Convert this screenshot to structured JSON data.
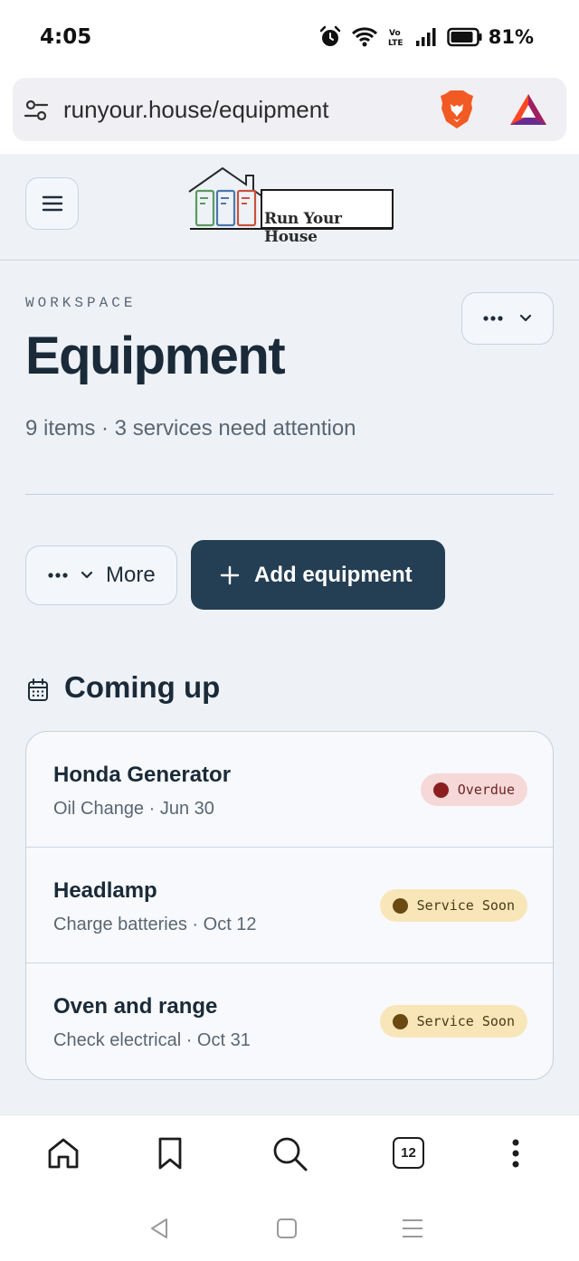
{
  "status_bar": {
    "time": "4:05",
    "battery_percent": "81%",
    "icons": [
      "alarm-icon",
      "wifi-icon",
      "volte-icon",
      "signal-icon",
      "battery-icon"
    ],
    "volte_label": "Vo LTE"
  },
  "browser": {
    "url": "runyour.house/equipment",
    "tabs_count": "12",
    "icons": [
      "site-settings-icon",
      "brave-shields-icon",
      "brave-rewards-icon"
    ]
  },
  "site": {
    "logo_text": "Run Your House"
  },
  "page": {
    "eyebrow": "WORKSPACE",
    "title": "Equipment",
    "subtitle": "9 items · 3 services need attention",
    "more_label": "More",
    "add_label": "Add equipment"
  },
  "coming_up": {
    "title": "Coming up",
    "items": [
      {
        "name": "Honda Generator",
        "detail": "Oil Change · Jun 30",
        "status": "Overdue"
      },
      {
        "name": "Headlamp",
        "detail": "Charge batteries · Oct 12",
        "status": "Service Soon"
      },
      {
        "name": "Oven and range",
        "detail": "Check electrical · Oct 31",
        "status": "Service Soon"
      }
    ]
  },
  "colors": {
    "primary_button": "#243f54",
    "overdue_bg": "#f6d8d8",
    "overdue_dot": "#8b1f1f",
    "soon_bg": "#f8e6b9",
    "soon_dot": "#6a4a12",
    "page_bg": "#eef2f7"
  }
}
